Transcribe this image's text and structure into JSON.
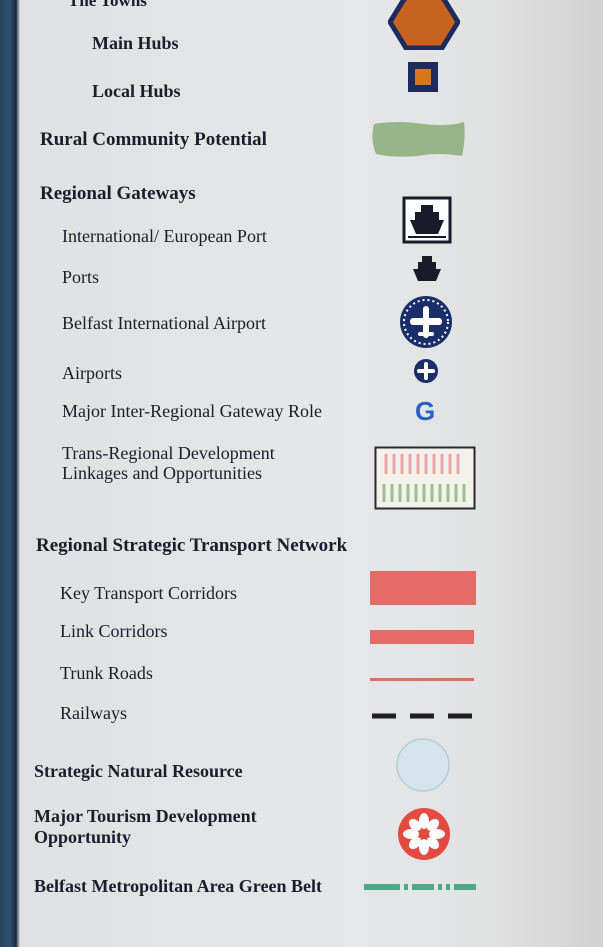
{
  "legend": {
    "towns_header": "The Towns",
    "main_hubs": "Main Hubs",
    "local_hubs": "Local Hubs",
    "rural_community_potential": "Rural Community Potential",
    "regional_gateways": "Regional Gateways",
    "intl_european_port": "International/ European Port",
    "ports": "Ports",
    "belfast_intl_airport": "Belfast International Airport",
    "airports": "Airports",
    "major_gateway_role": "Major Inter-Regional Gateway Role",
    "gateway_symbol_letter": "G",
    "trans_regional": "Trans-Regional Development Linkages and Opportunities",
    "transport_network": "Regional Strategic Transport Network",
    "key_transport_corridors": "Key Transport Corridors",
    "link_corridors": "Link Corridors",
    "trunk_roads": "Trunk Roads",
    "railways": "Railways",
    "strategic_natural_resource": "Strategic Natural Resource",
    "major_tourism": "Major Tourism Development Opportunity",
    "green_belt": "Belfast Metropolitan Area Green Belt"
  },
  "colors": {
    "main_hub_fill": "#c8621f",
    "hub_outline": "#1c2a5e",
    "local_hub_fill": "#d8761e",
    "rural_green": "#8fae7e",
    "navy": "#1a2f6a",
    "gateway_blue": "#2b5fc8",
    "corridor_red": "#e46b66",
    "railway": "#1e1e24",
    "natural_resource_fill": "#d6e4ec",
    "tourism_red": "#e34a40",
    "green_belt": "#4fa886"
  },
  "icons": {
    "main_hub": "hexagon-icon",
    "local_hub": "square-icon",
    "port": "ship-icon",
    "airport": "airplane-icon"
  }
}
